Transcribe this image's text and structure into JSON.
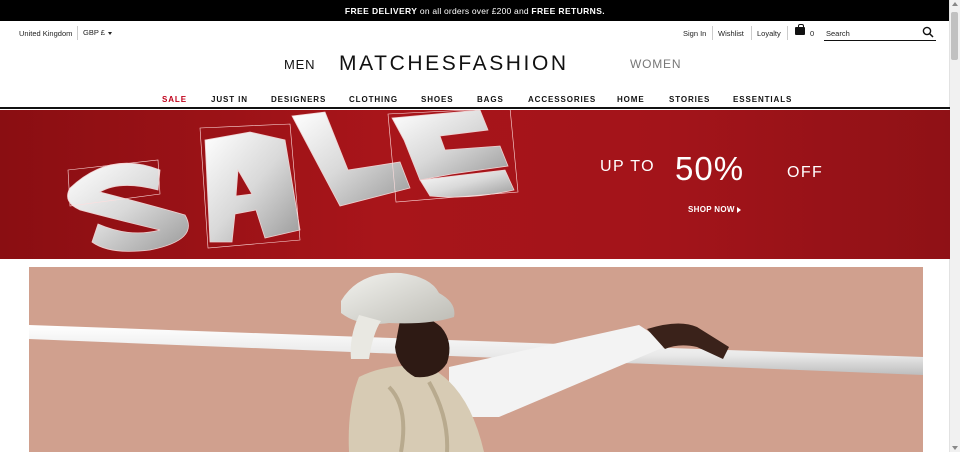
{
  "promo": {
    "pre": "FREE DELIVERY",
    "mid": " on all orders over £200 and ",
    "post": "FREE RETURNS."
  },
  "utility": {
    "country": "United Kingdom",
    "currency": "GBP £",
    "sign_in": "Sign In",
    "wishlist": "Wishlist",
    "loyalty": "Loyalty",
    "bag_count": "0",
    "search_placeholder": "Search"
  },
  "brand": {
    "men": "MEN",
    "logo": "MATCHESFASHION",
    "women": "WOMEN"
  },
  "nav": {
    "items": [
      "SALE",
      "JUST IN",
      "DESIGNERS",
      "CLOTHING",
      "SHOES",
      "BAGS",
      "ACCESSORIES",
      "HOME",
      "STORIES",
      "ESSENTIALS"
    ]
  },
  "hero": {
    "up_to": "UP TO",
    "percent": "50%",
    "off": "OFF",
    "cta": "SHOP NOW"
  },
  "colors": {
    "sale_red": "#c0001a",
    "hero_red": "#a3141a",
    "photo_bg": "#d0a08e"
  },
  "icons": [
    "search-icon",
    "bag-icon",
    "chevron-down-icon",
    "chevron-right-icon"
  ]
}
